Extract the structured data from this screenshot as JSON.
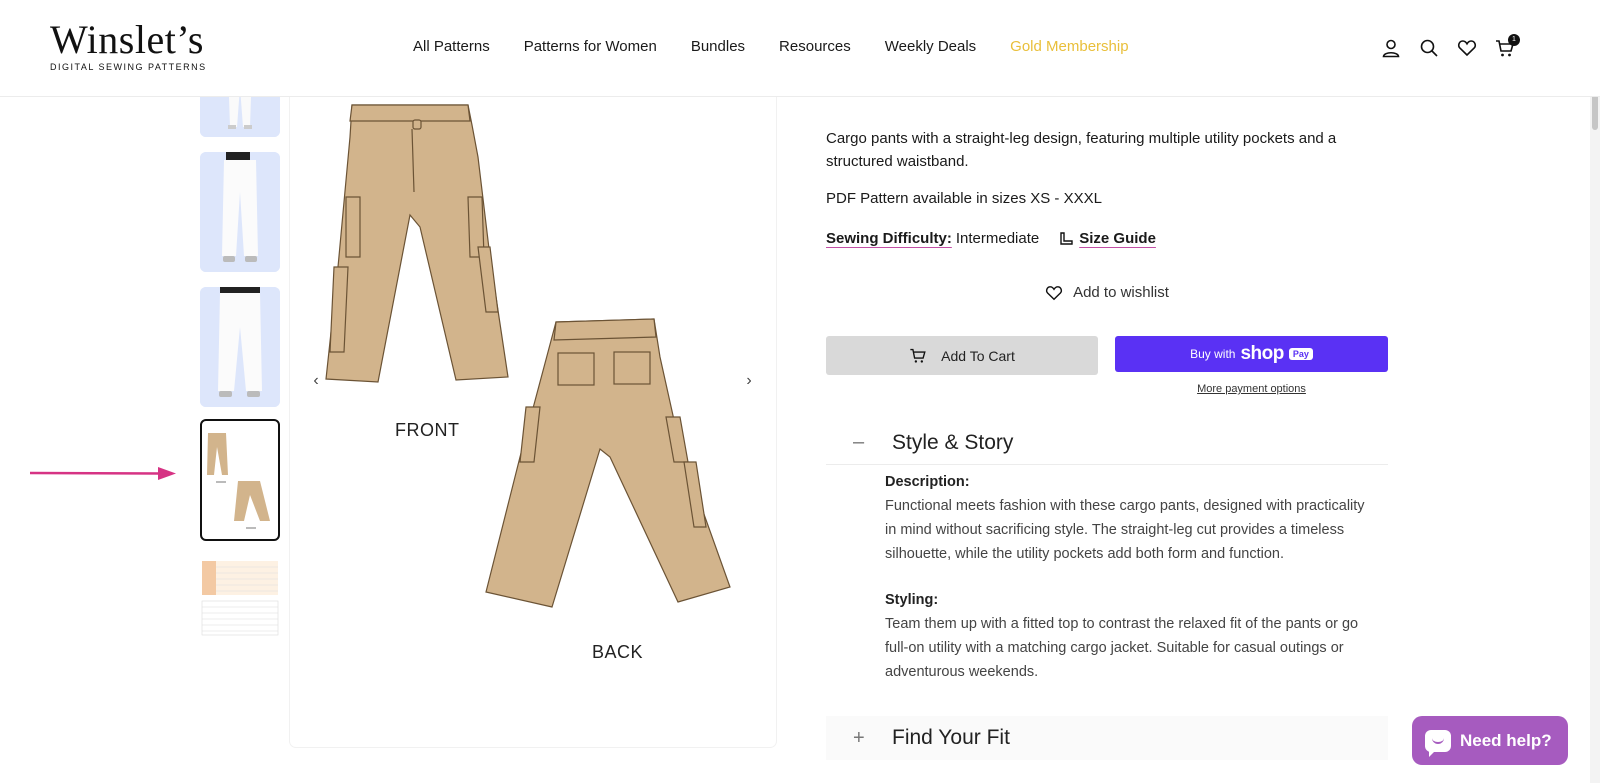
{
  "brand": {
    "name": "Winslet’s",
    "tagline": "DIGITAL SEWING PATTERNS"
  },
  "nav": {
    "items": [
      {
        "label": "All Patterns"
      },
      {
        "label": "Patterns for Women"
      },
      {
        "label": "Bundles"
      },
      {
        "label": "Resources"
      },
      {
        "label": "Weekly Deals"
      },
      {
        "label": "Gold Membership"
      }
    ],
    "gold_color": "#e9bf3a"
  },
  "header_icons": [
    "account-icon",
    "search-icon",
    "heart-icon",
    "cart-icon"
  ],
  "cart": {
    "count": "1"
  },
  "gallery": {
    "front_label": "FRONT",
    "back_label": "BACK",
    "prev": "‹",
    "next": "›",
    "pants_color": "#d2b48c"
  },
  "product": {
    "short_description": "Cargo pants with a straight-leg design, featuring multiple utility pockets and a structured waistband.",
    "sizes": "PDF Pattern available in sizes XS - XXXL",
    "difficulty_label": "Sewing Difficulty:",
    "difficulty_value": "Intermediate",
    "size_guide": "Size Guide",
    "wishlist": "Add to wishlist",
    "add_to_cart": "Add To Cart",
    "buy_with": "Buy with",
    "shop_word": "shop",
    "pay_word": "Pay",
    "more_payment": "More payment options",
    "shop_pay_color": "#5a31f4"
  },
  "accordion": {
    "style_story": {
      "toggle": "–",
      "title": "Style & Story",
      "description_heading": "Description:",
      "description": "Functional meets fashion with these cargo pants, designed with practicality in mind without sacrificing style. The straight-leg cut provides a timeless silhouette, while the utility pockets add both form and function.",
      "styling_heading": "Styling:",
      "styling": "Team them up with a fitted top to contrast the relaxed fit of the pants or go full-on utility with a matching cargo jacket. Suitable for casual outings or adventurous weekends."
    },
    "find_fit": {
      "toggle": "+",
      "title": "Find Your Fit"
    }
  },
  "chat": {
    "label": "Need help?",
    "color": "#a65bbf"
  },
  "annotation_arrow_color": "#d63384"
}
